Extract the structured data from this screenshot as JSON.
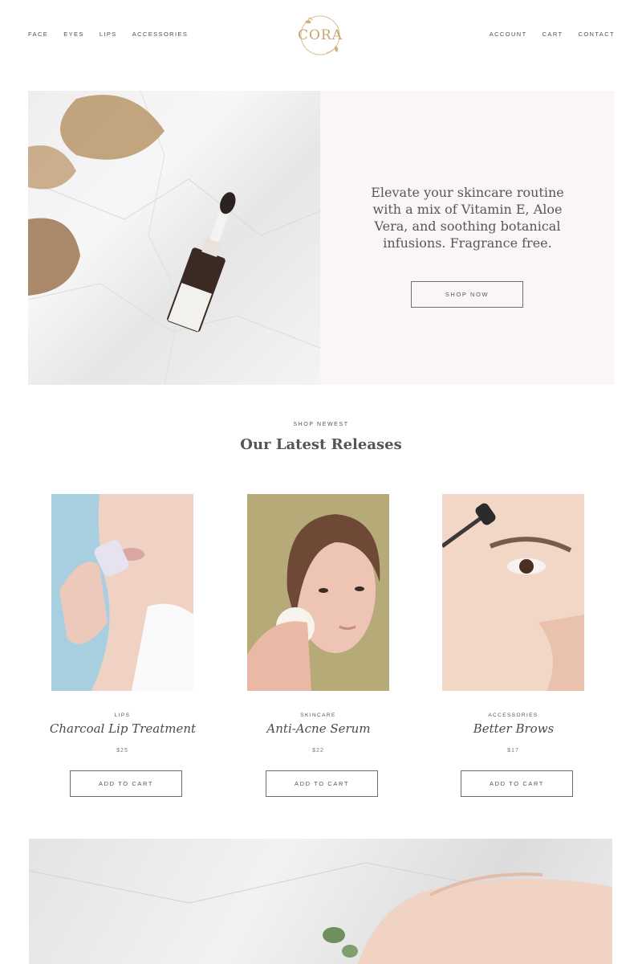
{
  "nav": {
    "left": [
      "FACE",
      "EYES",
      "LIPS",
      "ACCESSORIES"
    ],
    "right": [
      "ACCOUNT",
      "CART",
      "CONTACT"
    ]
  },
  "logo": {
    "text": "CORA"
  },
  "hero": {
    "text": "Elevate your skincare routine with a mix of Vitamin E, Aloe Vera, and soothing botanical infusions. Fragrance free.",
    "button": "SHOP NOW"
  },
  "section": {
    "kicker": "SHOP NEWEST",
    "title": "Our Latest Releases"
  },
  "products": [
    {
      "category": "LIPS",
      "name": "Charcoal Lip Treatment",
      "price": "$25",
      "button": "ADD TO CART"
    },
    {
      "category": "SKINCARE",
      "name": "Anti-Acne Serum",
      "price": "$22",
      "button": "ADD TO CART"
    },
    {
      "category": "ACCESSORIES",
      "name": "Better Brows",
      "price": "$17",
      "button": "ADD TO CART"
    }
  ],
  "colors": {
    "accent_gold": "#c8a470",
    "hero_panel": "#f9f6f5",
    "text": "#4a4a4a"
  }
}
